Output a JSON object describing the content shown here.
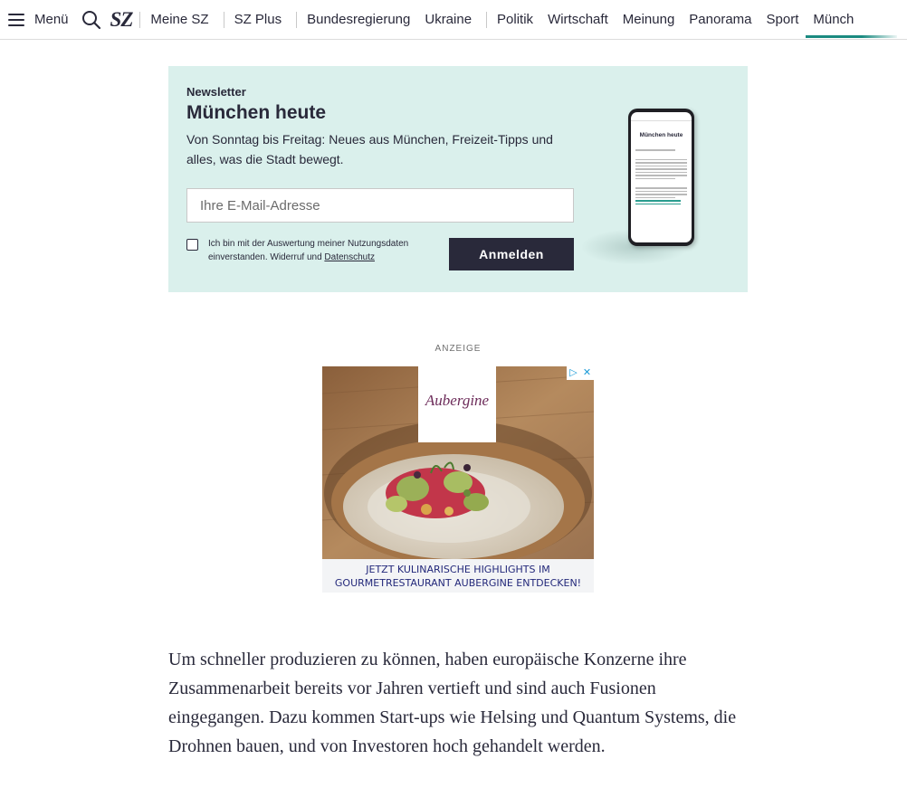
{
  "nav": {
    "menu_label": "Menü",
    "logo": "SZ",
    "items": [
      "Meine SZ",
      "SZ Plus",
      "Bundesregierung",
      "Ukraine",
      "Politik",
      "Wirtschaft",
      "Meinung",
      "Panorama",
      "Sport",
      "Münch"
    ],
    "active_item": "Münch"
  },
  "newsletter": {
    "kicker": "Newsletter",
    "title": "München heute",
    "description": "Von Sonntag bis Freitag: Neues aus München, Freizeit-Tipps und alles, was die Stadt bewegt.",
    "email_placeholder": "Ihre E-Mail-Adresse",
    "consent_text": "Ich bin mit der Auswertung meiner Nutzungsdaten einverstanden. Widerruf und ",
    "consent_link": "Datenschutz",
    "submit_label": "Anmelden",
    "checkbox_checked": false,
    "preview_title": "München heute"
  },
  "ad": {
    "label": "ANZEIGE",
    "brand": "Aubergine",
    "banner_line1": "JETZT KULINARISCHE HIGHLIGHTS IM",
    "banner_line2": "GOURMETRESTAURANT AUBERGINE ENTDECKEN!"
  },
  "article": {
    "paragraph": "Um schneller produzieren zu können, haben europäische Konzerne ihre Zusammenarbeit bereits vor Jahren vertieft und sind auch Fusionen eingegangen. Dazu kommen Start-ups wie Helsing und Quantum Systems, die Drohnen bauen, und von Investoren hoch gehandelt werden."
  },
  "colors": {
    "newsletter_bg": "#daf0ec",
    "button_bg": "#29293a",
    "accent": "#1a8a80"
  }
}
